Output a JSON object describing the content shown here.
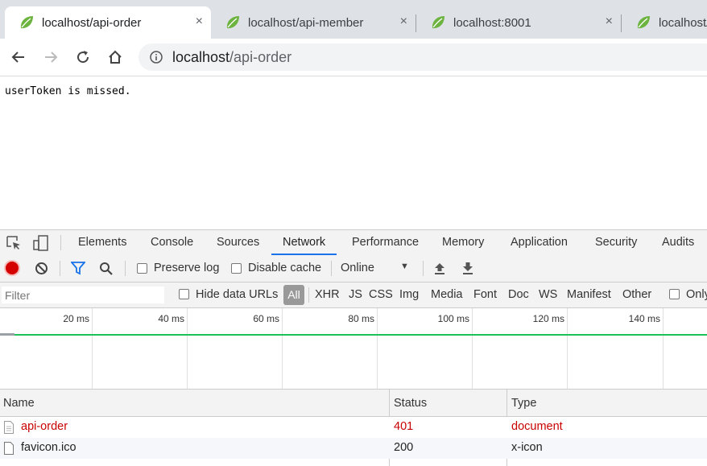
{
  "browser": {
    "tabs": [
      {
        "title": "localhost/api-order",
        "active": true
      },
      {
        "title": "localhost/api-member",
        "active": false
      },
      {
        "title": "localhost:8001",
        "active": false
      },
      {
        "title": "localhost/",
        "active": false
      }
    ],
    "close_glyph": "×",
    "address": {
      "host": "localhost",
      "path": "/api-order"
    }
  },
  "page": {
    "body_text": "userToken is missed."
  },
  "devtools": {
    "tabs": [
      "Elements",
      "Console",
      "Sources",
      "Network",
      "Performance",
      "Memory",
      "Application",
      "Security",
      "Audits"
    ],
    "selected_tab": "Network",
    "toolbar": {
      "preserve_log": "Preserve log",
      "disable_cache": "Disable cache",
      "throttle": "Online"
    },
    "filter": {
      "placeholder": "Filter",
      "hide_data_urls": "Hide data URLs",
      "types": [
        "All",
        "XHR",
        "JS",
        "CSS",
        "Img",
        "Media",
        "Font",
        "Doc",
        "WS",
        "Manifest",
        "Other"
      ],
      "only": "Only"
    },
    "timeline": {
      "ticks": [
        "20 ms",
        "40 ms",
        "60 ms",
        "80 ms",
        "100 ms",
        "120 ms",
        "140 ms"
      ]
    },
    "table": {
      "columns": [
        "Name",
        "Status",
        "Type"
      ],
      "rows": [
        {
          "name": "api-order",
          "status": "401",
          "type": "document",
          "error": true
        },
        {
          "name": "favicon.ico",
          "status": "200",
          "type": "x-icon",
          "error": false
        }
      ]
    }
  },
  "colors": {
    "error": "#c80000",
    "accent": "#1a73e8",
    "timeline": "#1ec05a",
    "record": "#d40000"
  }
}
